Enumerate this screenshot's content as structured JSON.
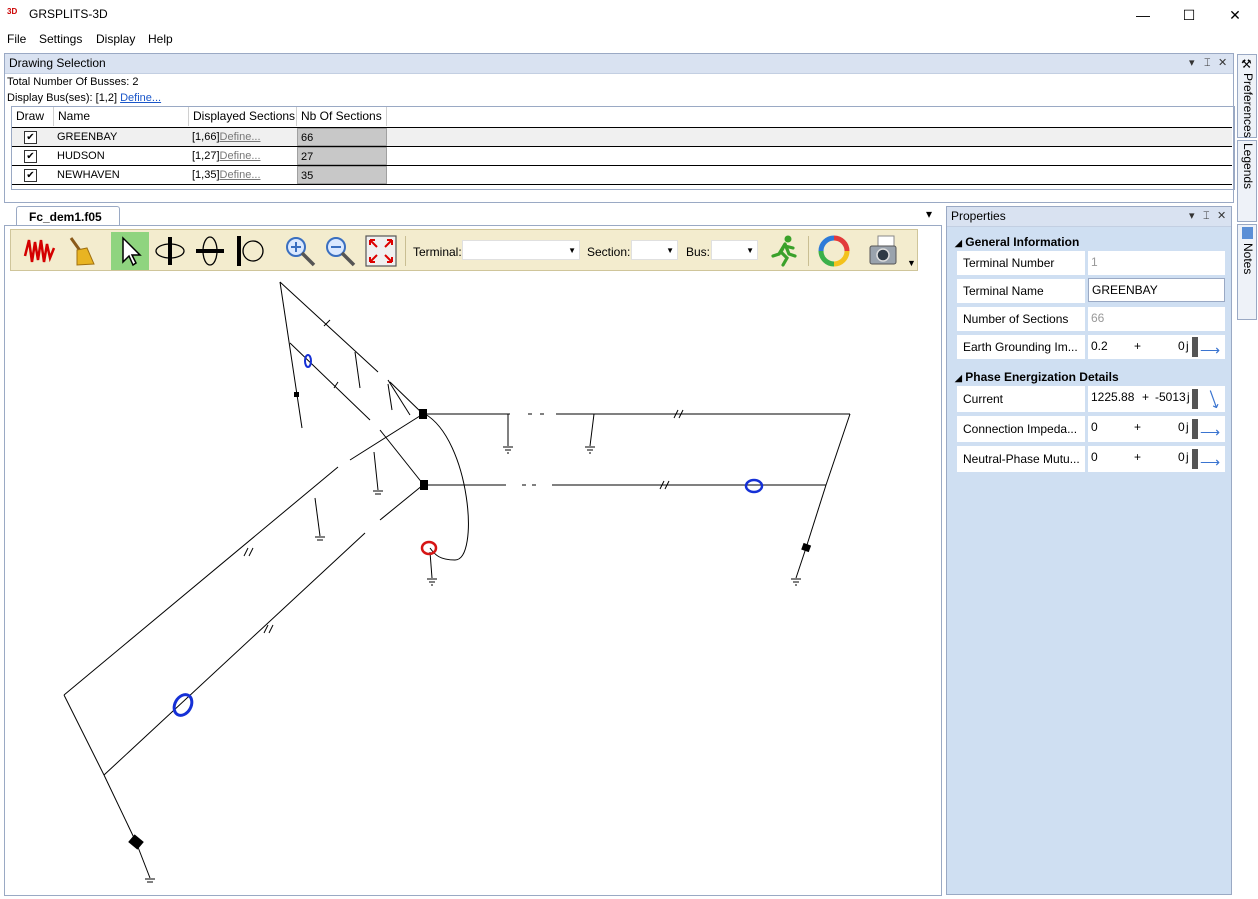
{
  "window": {
    "title": "GRSPLITS-3D",
    "icon_text": "3D",
    "minimize": "—",
    "maximize": "☐",
    "close": "✕"
  },
  "menu": [
    "File",
    "Settings",
    "Display",
    "Help"
  ],
  "drawing_selection": {
    "title": "Drawing Selection",
    "total_label": "Total Number Of Busses: 2",
    "display_label": "Display Bus(ses): [1,2]",
    "define": "Define...",
    "columns": [
      "Draw",
      "Name",
      "Displayed Sections",
      "Nb Of Sections"
    ],
    "rows": [
      {
        "checked": "✔",
        "name": "GREENBAY",
        "sections": "[1,66]",
        "define": "Define...",
        "nb": "66"
      },
      {
        "checked": "✔",
        "name": "HUDSON",
        "sections": "[1,27]",
        "define": "Define...",
        "nb": "27"
      },
      {
        "checked": "✔",
        "name": "NEWHAVEN",
        "sections": "[1,35]",
        "define": "Define...",
        "nb": "35"
      }
    ]
  },
  "document": {
    "tab_label": "Fc_dem1.f05",
    "close": "✕",
    "overflow": "▾"
  },
  "toolbar": {
    "terminal_label": "Terminal:",
    "section_label": "Section:",
    "bus_label": "Bus:"
  },
  "properties": {
    "title": "Properties",
    "general_title": "General Information",
    "general": [
      {
        "label": "Terminal Number",
        "value": "1"
      },
      {
        "label": "Terminal Name",
        "value": "GREENBAY"
      },
      {
        "label": "Number of Sections",
        "value": "66"
      },
      {
        "label": "Earth Grounding Im...",
        "real": "0.2",
        "plus": "+",
        "imag": "0",
        "j": "j"
      }
    ],
    "phase_title": "Phase Energization Details",
    "phase": [
      {
        "label": "Current",
        "real": "1225.88",
        "plus": "+",
        "imag": "-5013",
        "j": "j"
      },
      {
        "label": "Connection Impeda...",
        "real": "0",
        "plus": "+",
        "imag": "0",
        "j": "j"
      },
      {
        "label": "Neutral-Phase Mutu...",
        "real": "0",
        "plus": "+",
        "imag": "0",
        "j": "j"
      }
    ]
  },
  "side_tabs": [
    "Preferences",
    "Color Legends",
    "Release Notes"
  ],
  "panel_icons": {
    "dropdown": "▾",
    "pin": "⌶",
    "close": "✕"
  }
}
